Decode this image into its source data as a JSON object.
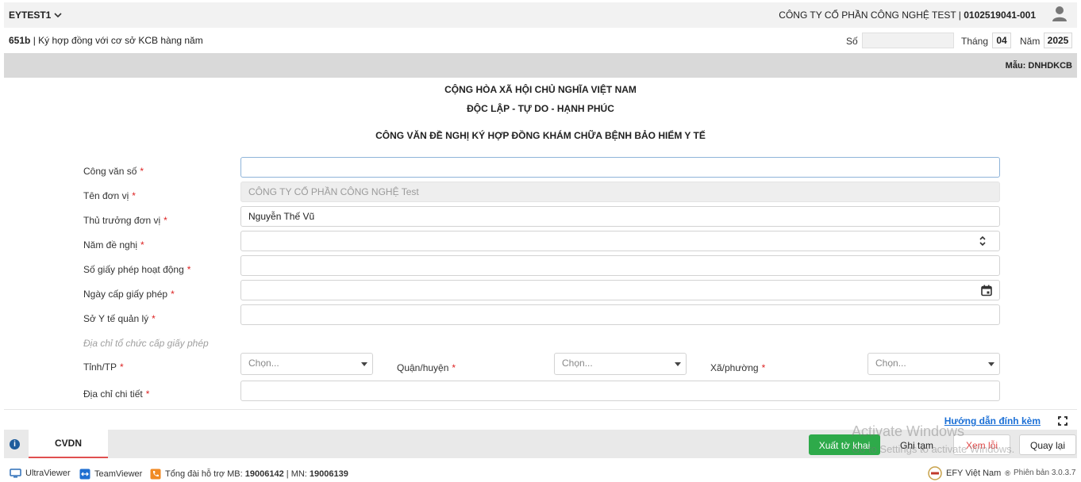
{
  "topbar": {
    "user": "EYTEST1",
    "company_name": "CÔNG TY CỔ PHẦN CÔNG NGHỆ TEST | ",
    "tax_code": "0102519041-001"
  },
  "subheader": {
    "form_code": "651b",
    "form_title": " | Ký hợp đồng với cơ sở KCB hàng năm",
    "so_label": "Số",
    "so_value": "",
    "thang_label": "Tháng",
    "thang_value": "04",
    "nam_label": "Năm",
    "nam_value": "2025"
  },
  "mau": "Mẫu: DNHDKCB",
  "document": {
    "heading1": "CỘNG HÒA XÃ HỘI CHỦ NGHĨA VIỆT NAM",
    "heading2": "ĐỘC LẬP - TỰ DO - HẠNH PHÚC",
    "heading3": "CÔNG VĂN ĐỀ NGHỊ KÝ HỢP ĐỒNG KHÁM CHỮA BỆNH BẢO HIỂM Y TẾ"
  },
  "form": {
    "required_mark": "*",
    "cong_van_so": {
      "label": "Công văn số",
      "value": ""
    },
    "ten_don_vi": {
      "label": "Tên đơn vị",
      "value": "CÔNG TY CỔ PHẦN CÔNG NGHỆ Test"
    },
    "thu_truong": {
      "label": "Thủ trưởng đơn vị",
      "value": "Nguyễn Thế Vũ"
    },
    "nam_de_nghi": {
      "label": "Năm đề nghị",
      "value": ""
    },
    "so_giay_phep": {
      "label": "Số giấy phép hoạt động",
      "value": ""
    },
    "ngay_cap": {
      "label": "Ngày cấp giấy phép",
      "value": ""
    },
    "so_y_te": {
      "label": "Sở Y tế quản lý",
      "value": ""
    },
    "dia_chi_group": "Địa chỉ tổ chức cấp giấy phép",
    "tinh": {
      "label": "Tỉnh/TP",
      "placeholder": "Chọn..."
    },
    "quan": {
      "label": "Quận/huyện",
      "placeholder": "Chọn..."
    },
    "xa": {
      "label": "Xã/phường",
      "placeholder": "Chọn..."
    },
    "dia_chi_chi_tiet": {
      "label": "Địa chỉ chi tiết",
      "value": ""
    }
  },
  "help_link": "Hướng dẫn đính kèm",
  "bottom": {
    "tab_label": "CVDN",
    "export_button": "Xuất tờ khai",
    "save_temp_button": "Ghi tạm",
    "view_errors_button": "Xem lỗi",
    "back_button": "Quay lại"
  },
  "statusbar": {
    "ultraviewer": "UltraViewer",
    "teamviewer": "TeamViewer",
    "support_prefix": "Tổng đài hỗ trợ MB: ",
    "mb_phone": "19006142",
    "mn_prefix": " | MN: ",
    "mn_phone": "19006139",
    "brand": "EFY Việt Nam",
    "version": "Phiên bản 3.0.3.7"
  },
  "watermark": {
    "line1": "Activate Windows",
    "line2": "Go to Settings to activate Windows."
  },
  "colors": {
    "accent_green": "#2eaa4a",
    "link_blue": "#1a6fd6",
    "required_red": "#d22222",
    "tab_underline": "#e05050"
  }
}
